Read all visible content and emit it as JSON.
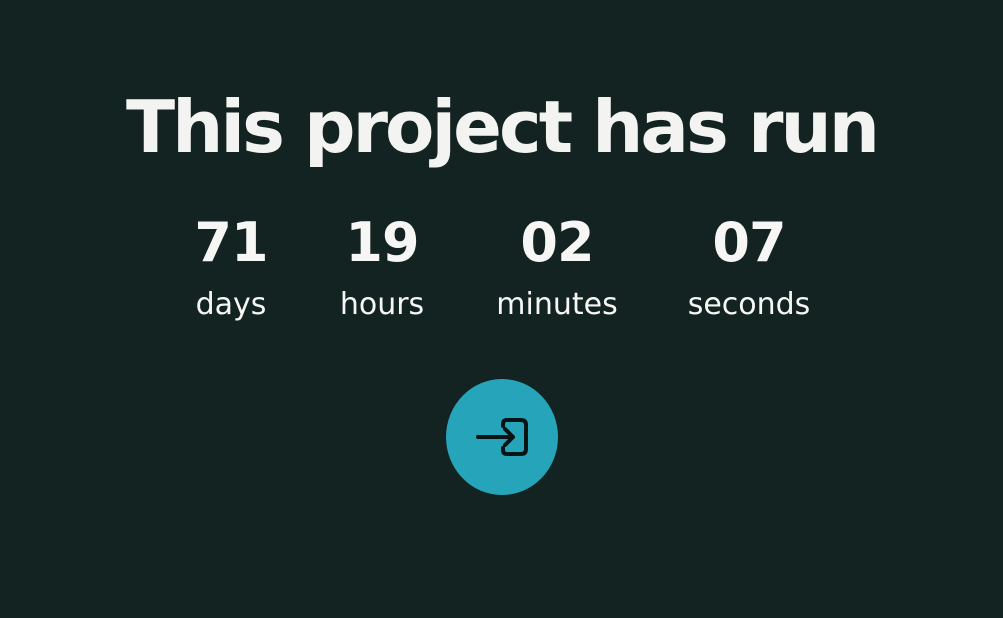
{
  "title": "This project has run",
  "countdown": [
    {
      "value": "71",
      "label": "days"
    },
    {
      "value": "19",
      "label": "hours"
    },
    {
      "value": "02",
      "label": "minutes"
    },
    {
      "value": "07",
      "label": "seconds"
    }
  ],
  "enter_button": {
    "icon": "enter-icon",
    "color": "#26a4b9"
  },
  "colors": {
    "background": "#132321",
    "text": "#f3f3f1",
    "accent": "#26a4b9"
  }
}
